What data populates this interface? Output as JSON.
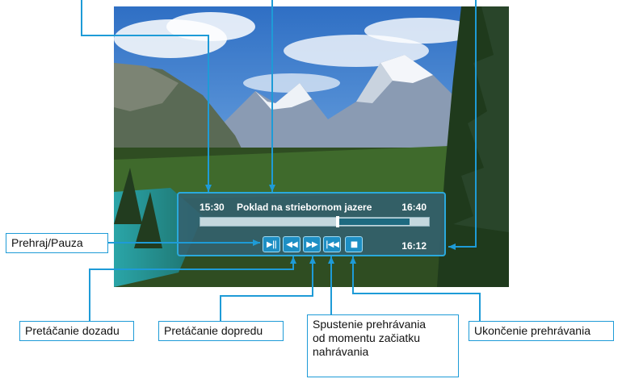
{
  "player": {
    "start_time": "15:30",
    "program_title": "Poklad na striebornom jazere",
    "end_time": "16:40",
    "current_time": "16:12",
    "progress_fraction": 0.6
  },
  "buttons": [
    {
      "name": "play-pause-button",
      "glyph": "▶||"
    },
    {
      "name": "rewind-button",
      "glyph": "◀◀"
    },
    {
      "name": "fast-forward-button",
      "glyph": "▶▶"
    },
    {
      "name": "restart-button",
      "glyph": "|◀◀"
    },
    {
      "name": "stop-button",
      "glyph": "■"
    }
  ],
  "callouts": {
    "play_pause": "Prehraj/Pauza",
    "rewind": "Pretáčanie dozadu",
    "fast_forward": "Pretáčanie dopredu",
    "restart_line1": "Spustenie prehrávania",
    "restart_line2": "od momentu začiatku",
    "restart_line3": "nahrávania",
    "stop": "Ukončenie prehrávania"
  },
  "colors": {
    "accent": "#1e9bd7",
    "osd_background": "#346270",
    "button": "#1e8fc4"
  },
  "icons": [
    "play-pause-icon",
    "rewind-icon",
    "fast-forward-icon",
    "restart-icon",
    "stop-icon"
  ]
}
